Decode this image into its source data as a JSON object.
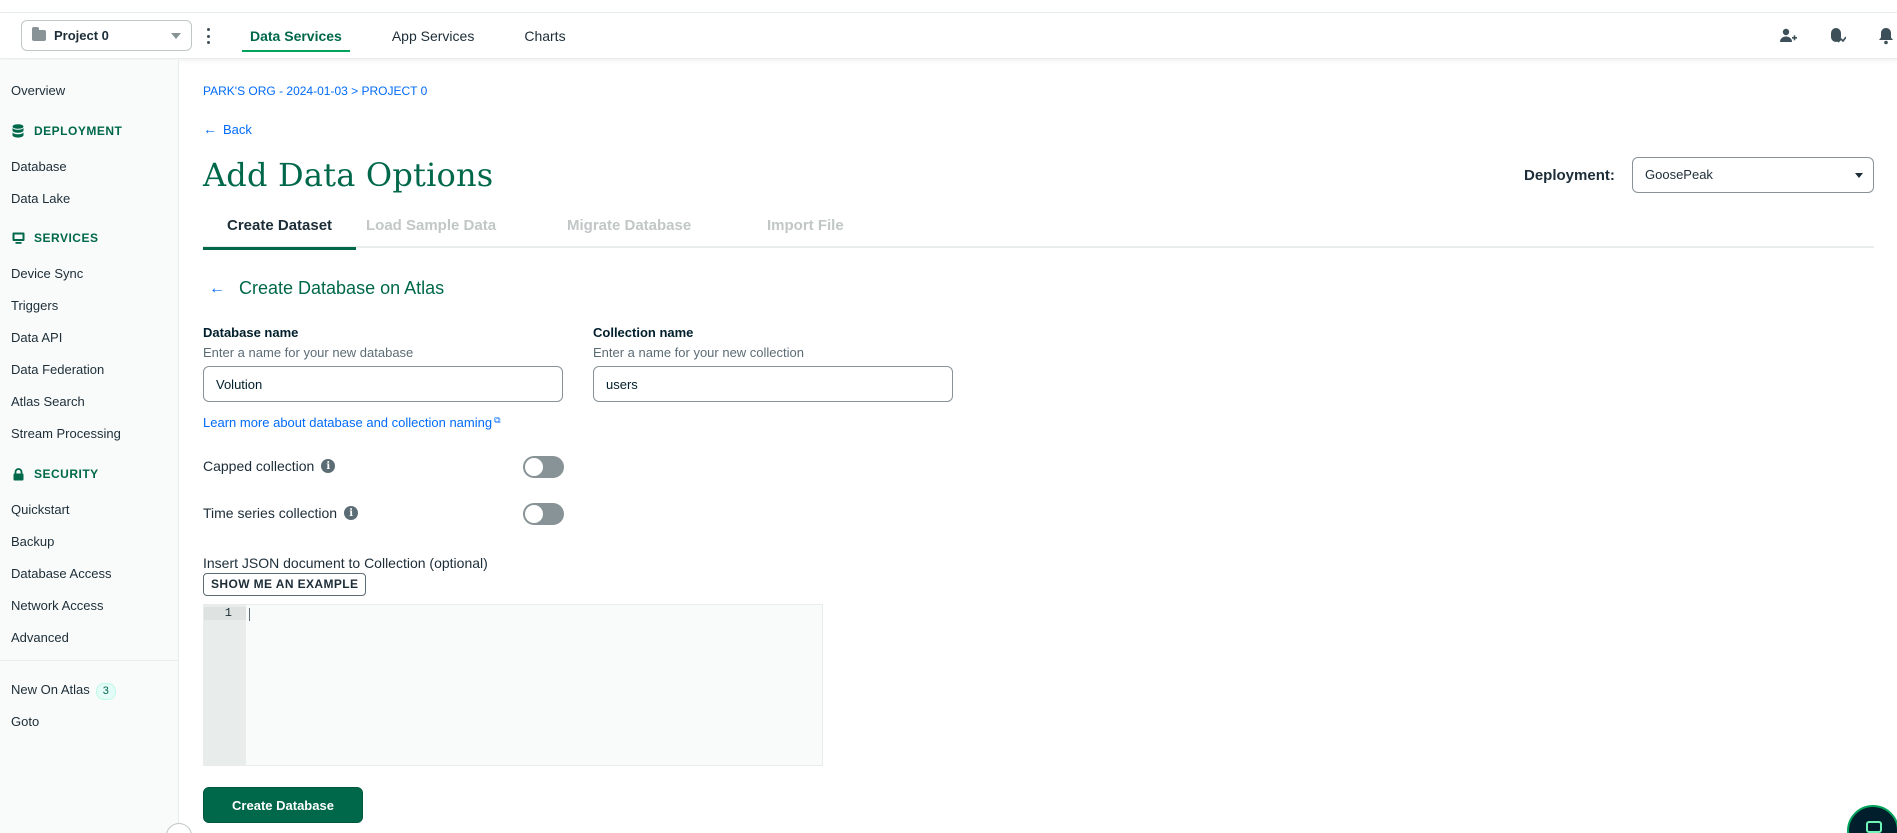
{
  "topbar": {
    "project": "Project 0",
    "nav": [
      "Data Services",
      "App Services",
      "Charts"
    ],
    "active_nav": "Data Services"
  },
  "sidebar": {
    "overview": "Overview",
    "deployment_heading": "DEPLOYMENT",
    "database": "Database",
    "data_lake": "Data Lake",
    "services_heading": "SERVICES",
    "device_sync": "Device Sync",
    "triggers": "Triggers",
    "data_api": "Data API",
    "data_federation": "Data Federation",
    "atlas_search": "Atlas Search",
    "stream_processing": "Stream Processing",
    "security_heading": "SECURITY",
    "quickstart": "Quickstart",
    "backup": "Backup",
    "database_access": "Database Access",
    "network_access": "Network Access",
    "advanced": "Advanced",
    "new_on_atlas": "New On Atlas",
    "new_on_atlas_count": "3",
    "goto": "Goto"
  },
  "main": {
    "breadcrumb": "PARK'S ORG - 2024-01-03 > PROJECT 0",
    "back": "Back",
    "title": "Add Data Options",
    "deployment_label": "Deployment:",
    "deployment_value": "GoosePeak",
    "tabs": [
      "Create Dataset",
      "Load Sample Data",
      "Migrate Database",
      "Import File"
    ],
    "active_tab": "Create Dataset",
    "subtitle": "Create Database on Atlas",
    "db_name_label": "Database name",
    "db_name_desc": "Enter a name for your new database",
    "db_name_value": "Volution",
    "coll_name_label": "Collection name",
    "coll_name_desc": "Enter a name for your new collection",
    "coll_name_value": "users",
    "learn_more": "Learn more about database and collection naming",
    "capped_label": "Capped collection",
    "timeseries_label": "Time series collection",
    "json_label": "Insert JSON document to Collection (optional)",
    "example_button": "SHOW ME AN EXAMPLE",
    "editor_line": "1",
    "create_button": "Create Database"
  }
}
